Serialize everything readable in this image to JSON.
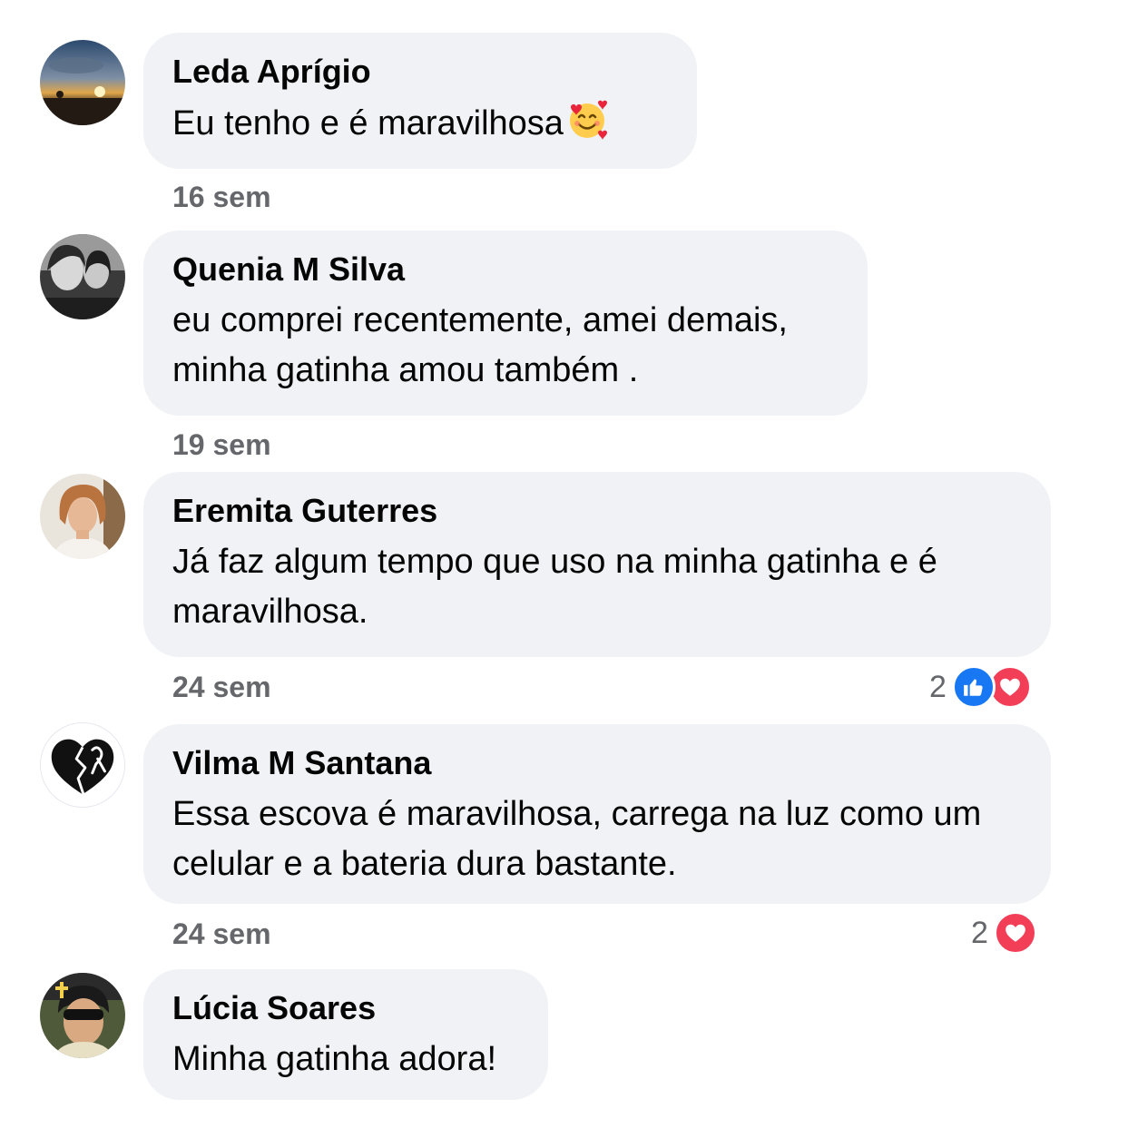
{
  "comments": [
    {
      "author": "Leda Aprígio",
      "text": "Eu tenho e é maravilhosa",
      "emoji": "smiling-face-with-hearts",
      "time": "16 sem"
    },
    {
      "author": "Quenia M Silva",
      "text_lines": [
        "eu comprei recentemente, amei demais,",
        "minha gatinha amou também ."
      ],
      "time": "19 sem"
    },
    {
      "author": "Eremita Guterres",
      "text_lines": [
        "Já faz algum tempo que uso na minha gatinha e é",
        "maravilhosa."
      ],
      "time": "24 sem",
      "reactions": {
        "count": "2",
        "types": [
          "like",
          "love"
        ]
      }
    },
    {
      "author": "Vilma M Santana",
      "text_lines": [
        "Essa escova é maravilhosa, carrega na luz como um",
        "celular e a bateria dura bastante."
      ],
      "time": "24 sem",
      "reactions": {
        "count": "2",
        "types": [
          "love"
        ]
      }
    },
    {
      "author": "Lúcia Soares",
      "text": "Minha gatinha adora!"
    }
  ],
  "colors": {
    "bubble": "#f0f2f5",
    "meta_text": "#65676b",
    "like": "#1877f2",
    "love": "#f33e58"
  }
}
